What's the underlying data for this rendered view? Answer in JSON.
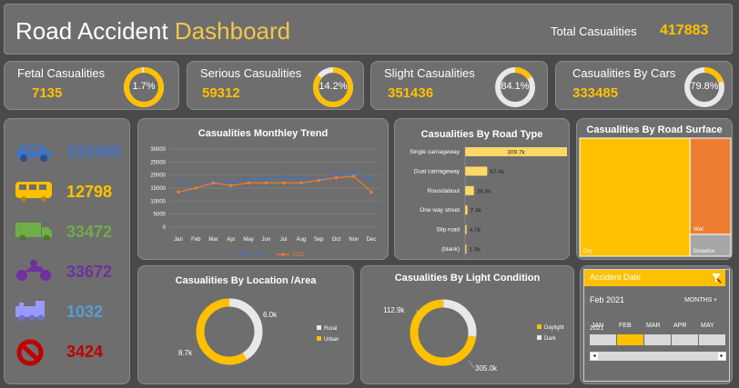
{
  "header": {
    "title_main": "Road Accident",
    "title_highlight": "Dashboard",
    "total_label": "Total Casualities",
    "total_value": "417883"
  },
  "kpis": [
    {
      "name": "Fetal Casualities",
      "value": "7135",
      "pct_label": "1.7%",
      "pct": 0.017
    },
    {
      "name": "Serious Casualities",
      "value": "59312",
      "pct_label": "14.2%",
      "pct": 0.142
    },
    {
      "name": "Slight Casualities",
      "value": "351436",
      "pct_label": "84.1%",
      "pct": 0.841
    },
    {
      "name": "Casualities By Cars",
      "value": "333485",
      "pct_label": "79.8%",
      "pct": 0.798
    }
  ],
  "vehicles": [
    {
      "icon": "car-icon",
      "value": "333485",
      "color": "#4472c4"
    },
    {
      "icon": "bus-icon",
      "value": "12798",
      "color": "#ffc000"
    },
    {
      "icon": "truck-icon",
      "value": "33472",
      "color": "#70ad47"
    },
    {
      "icon": "motorcycle-icon",
      "value": "33672",
      "color": "#7030a0"
    },
    {
      "icon": "train-icon",
      "value": "1032",
      "color": "#5b9bd5"
    },
    {
      "icon": "no-entry-icon",
      "value": "3424",
      "color": "#c00000"
    }
  ],
  "colors": {
    "yellow": "#ffc000",
    "orange": "#ed7d31",
    "blue": "#4472c4",
    "ring_track": "#e8e8e8"
  },
  "chart_data": [
    {
      "type": "line",
      "title": "Casualities Monthley Trend",
      "categories": [
        "Jan",
        "Feb",
        "Mar",
        "Apr",
        "May",
        "Jun",
        "Jul",
        "Aug",
        "Sep",
        "Oct",
        "Nov",
        "Dec"
      ],
      "yticks": [
        "0",
        "5000",
        "10000",
        "15000",
        "20000",
        "25000",
        "30000"
      ],
      "ylim": [
        0,
        30000
      ],
      "series": [
        {
          "name": "2021",
          "color": "#4472c4",
          "values": [
            18000,
            15000,
            17500,
            17500,
            18500,
            18500,
            19500,
            18500,
            18500,
            20000,
            21000,
            18500
          ]
        },
        {
          "name": "2022",
          "color": "#ed7d31",
          "values": [
            13500,
            15000,
            17000,
            16000,
            17000,
            17000,
            17000,
            17000,
            18000,
            19000,
            19500,
            13500
          ]
        }
      ]
    },
    {
      "type": "bar",
      "title": "Casualities By Road Type",
      "categories": [
        "Single carriageway",
        "Dual carriageway",
        "Roundabout",
        "One way street",
        "Slip road",
        "(blank)"
      ],
      "values": [
        309700,
        67400,
        26800,
        7400,
        4700,
        1900
      ],
      "labels": [
        "309.7k",
        "67.4k",
        "26.8k",
        "7.4k",
        "4.7k",
        "1.9k"
      ]
    },
    {
      "type": "treemap",
      "title": "Casualities By Road Surface",
      "items": [
        {
          "name": "Dry",
          "value": 0.73,
          "color": "#ffc000"
        },
        {
          "name": "Wet",
          "value": 0.22,
          "color": "#ed7d31"
        },
        {
          "name": "Snow/ice",
          "value": 0.05,
          "color": "#a6a6a6"
        }
      ]
    },
    {
      "type": "pie",
      "title": "Casualities By Location /Area",
      "slices": [
        {
          "name": "Rural",
          "label": "6.0k",
          "value": 0.41,
          "color": "#e8e8e8"
        },
        {
          "name": "Urban",
          "label": "8.7k",
          "value": 0.59,
          "color": "#ffc000"
        }
      ]
    },
    {
      "type": "pie",
      "title": "Casualities By Light Condition",
      "slices": [
        {
          "name": "Daylight",
          "label": "305.0k",
          "value": 0.73,
          "color": "#ffc000"
        },
        {
          "name": "Dark",
          "label": "112.9k",
          "value": 0.27,
          "color": "#e8e8e8"
        }
      ]
    }
  ],
  "slicer": {
    "title": "Accident Date",
    "selected": "Feb 2021",
    "granularity": "MONTHS",
    "months": [
      "JAN",
      "FEB",
      "MAR",
      "APR",
      "MAY"
    ],
    "year": "2021",
    "selected_index": 1
  }
}
